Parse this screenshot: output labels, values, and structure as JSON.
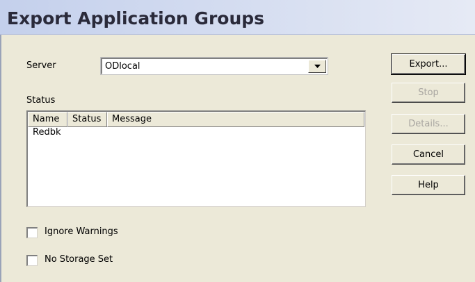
{
  "window": {
    "title": "Export Application Groups"
  },
  "server": {
    "label": "Server",
    "selected": "ODlocal"
  },
  "status_section": {
    "label": "Status",
    "columns": [
      "Name",
      "Status",
      "Message"
    ],
    "rows": [
      {
        "name": "Redbk",
        "status": "",
        "message": ""
      }
    ]
  },
  "buttons": {
    "export": "Export...",
    "stop": "Stop",
    "details": "Details...",
    "cancel": "Cancel",
    "help": "Help"
  },
  "options": {
    "ignore_warnings": {
      "label": "Ignore Warnings",
      "checked": false
    },
    "no_storage_set": {
      "label": "No Storage Set",
      "checked": false
    }
  },
  "icons": {
    "dropdown": "chevron-down-icon"
  },
  "colors": {
    "dialog_background": "#ece9d8",
    "title_gradient_start": "#c4d0ec",
    "disabled_text": "#a8a5a0"
  }
}
